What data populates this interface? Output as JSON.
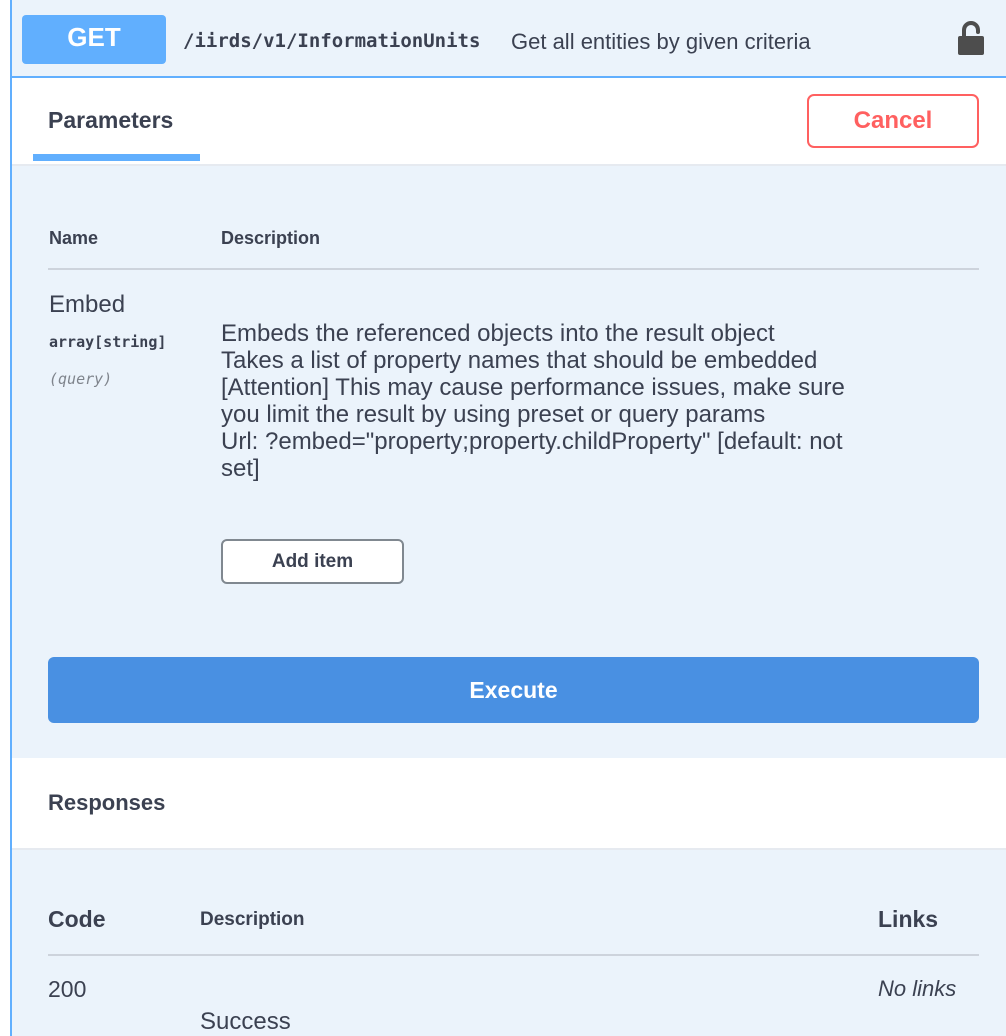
{
  "operation": {
    "method": "GET",
    "path": "/iirds/v1/InformationUnits",
    "summary": "Get all entities by given criteria",
    "lock_icon": "lock-icon"
  },
  "parameters_tab": {
    "title": "Parameters",
    "cancel_label": "Cancel"
  },
  "parameters_table": {
    "headers": {
      "name": "Name",
      "description": "Description"
    },
    "rows": [
      {
        "name": "Embed",
        "type": "array[string]",
        "in": "(query)",
        "description_lines": [
          "Embeds the referenced objects into the result object",
          "Takes a list of property names that should be embedded",
          "[Attention] This may cause performance issues, make sure",
          "you limit the result by using preset or query params",
          "Url: ?embed=\"property;property.childProperty\" [default: not",
          "set]"
        ],
        "add_item_label": "Add item"
      }
    ]
  },
  "execute_label": "Execute",
  "responses": {
    "title": "Responses",
    "headers": {
      "code": "Code",
      "description": "Description",
      "links": "Links"
    },
    "rows": [
      {
        "code": "200",
        "description": "Success",
        "links": "No links"
      }
    ]
  },
  "colors": {
    "get_blue": "#61affe",
    "block_bg": "#ebf3fb",
    "cancel_red": "#ff6060",
    "execute_blue": "#4990e2",
    "text": "#3b4151"
  }
}
